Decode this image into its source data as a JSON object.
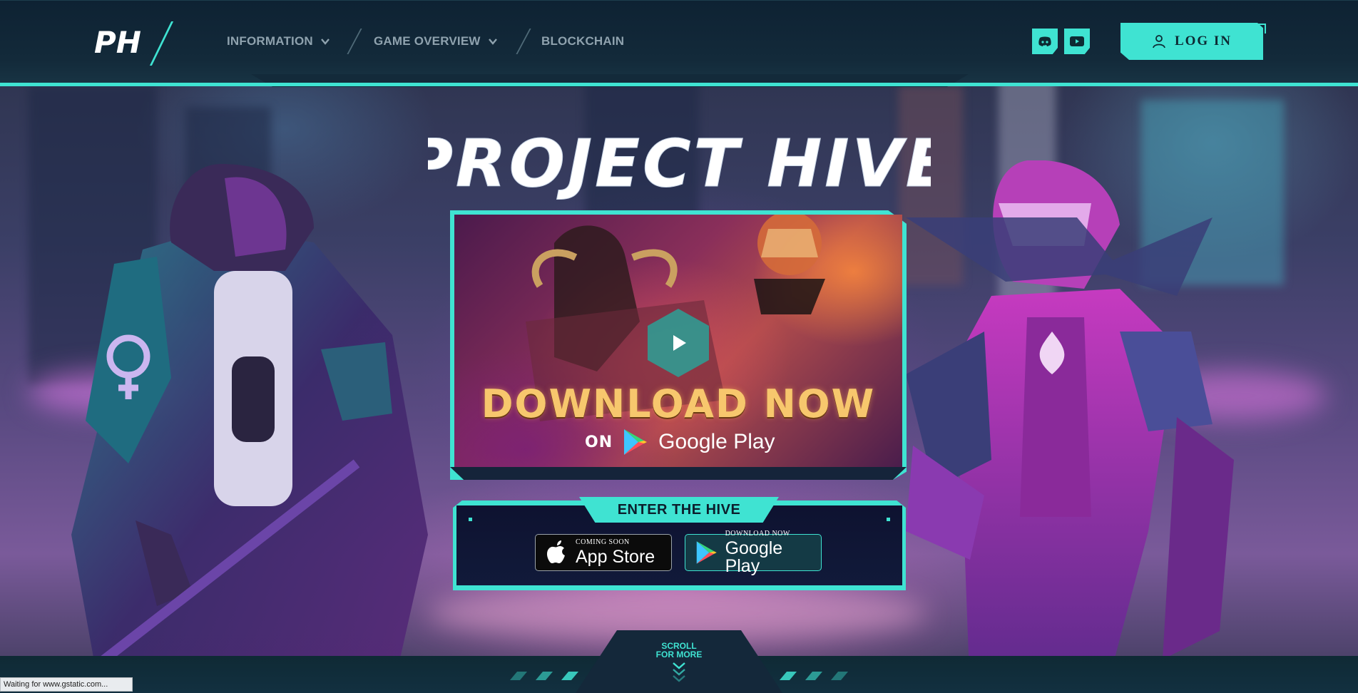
{
  "header": {
    "logo_text": "PH",
    "nav": [
      {
        "label": "INFORMATION",
        "has_dropdown": true
      },
      {
        "label": "GAME OVERVIEW",
        "has_dropdown": true
      },
      {
        "label": "BLOCKCHAIN",
        "has_dropdown": false
      }
    ],
    "social": [
      {
        "name": "discord-icon"
      },
      {
        "name": "youtube-icon"
      }
    ],
    "login_label": "LOG IN"
  },
  "hero": {
    "title": "PROJECT HIVE",
    "video": {
      "headline": "DOWNLOAD NOW",
      "on_label": "ON",
      "store_label": "Google Play",
      "play_icon": "play-icon"
    },
    "enter_hive": {
      "label": "ENTER THE HIVE",
      "app_store": {
        "small": "COMING SOON",
        "big": "App Store"
      },
      "google_play": {
        "small": "DOWNLOAD NOW",
        "big": "Google Play"
      }
    },
    "scroll": {
      "line1": "SCROLL",
      "line2": "FOR MORE"
    }
  },
  "status_bar": "Waiting for www.gstatic.com...",
  "colors": {
    "accent": "#3fe3d2",
    "header_bg": "#132a3a",
    "nav_text": "#8fa2ae",
    "headline_gold": "#f7c76d"
  }
}
